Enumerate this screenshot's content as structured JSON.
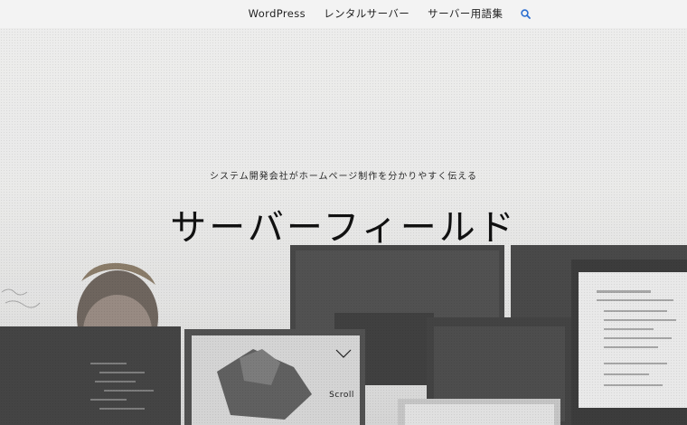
{
  "nav": {
    "items": [
      "WordPress",
      "レンタルサーバー",
      "サーバー用語集"
    ],
    "search_icon": "search-icon",
    "accent": "#2d6fd0"
  },
  "hero": {
    "tagline": "システム開発会社がホームページ制作を分かりやすく伝える",
    "title": "サーバーフィールド",
    "scroll_label": "Scroll"
  }
}
